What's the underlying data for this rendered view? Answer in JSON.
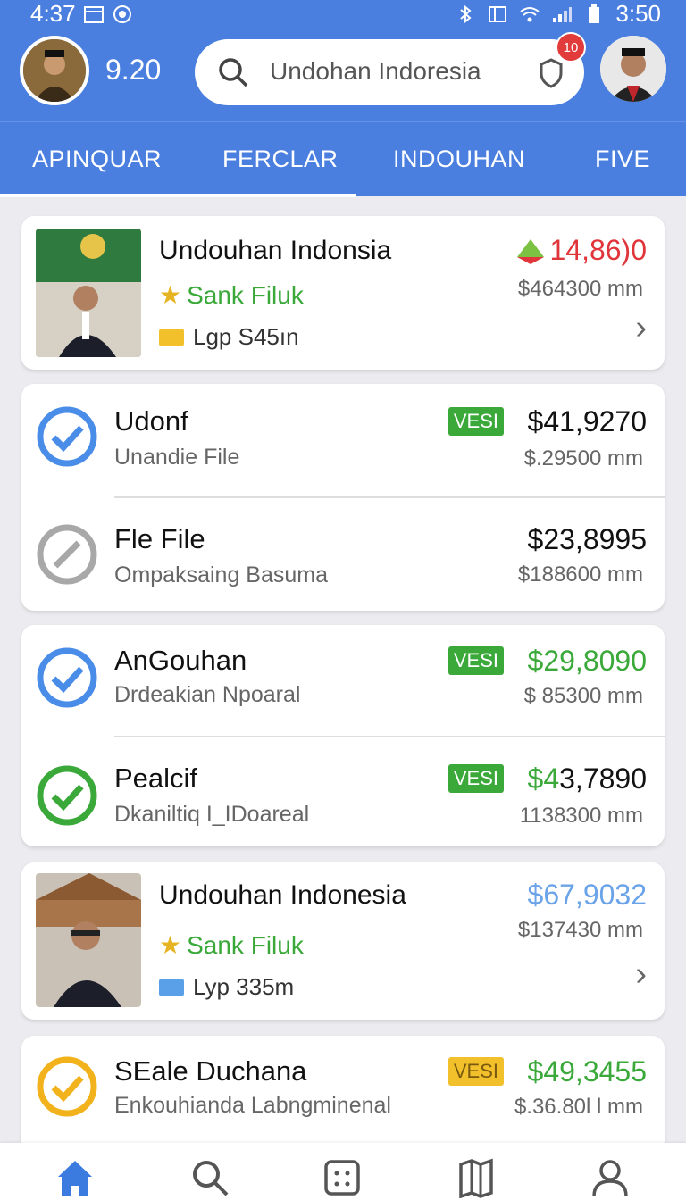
{
  "status_bar": {
    "left_time": "4:37",
    "right_time": "3:50"
  },
  "header": {
    "score": "9.20",
    "search_text": "Undohan Indoresia",
    "notification_count": "10"
  },
  "tabs": [
    "APINQUAR",
    "FERCLAR",
    "INDOUHAN",
    "FIVE"
  ],
  "feature_cards": [
    {
      "title": "Undouhan Indonsia",
      "rating_label": "Sank Filuk",
      "tag_label": "Lgp S45ın",
      "amount": "14,86)0",
      "amount_color": "#e0353a",
      "sub_amount": "$464300 mm"
    },
    {
      "title": "Undouhan Indonesia",
      "rating_label": "Sank Filuk",
      "tag_label": "Lyp 335m",
      "amount": "$67,9032",
      "amount_color": "#6aa3e8",
      "sub_amount": "$137430 mm"
    }
  ],
  "group_one": [
    {
      "title": "Udonf",
      "subtitle": "Unandie File",
      "badge": "VESI",
      "amount": "$41,9270",
      "sub_amount": "$.29500 mm"
    },
    {
      "title": "Fle File",
      "subtitle": "Ompaksaing Basuma",
      "badge": "",
      "amount": "$23,8995",
      "sub_amount": "$188600 mm"
    }
  ],
  "group_two": [
    {
      "title": "AnGouhan",
      "subtitle": "Drdeakian Npoaral",
      "badge": "VESI",
      "amount": "$29,8090",
      "sub_amount": "$ 85300 mm"
    },
    {
      "title": "Pealcif",
      "subtitle": "Dkaniltiq I_IDoareal",
      "badge": "VESI",
      "amount_green": "$4",
      "amount": "3,7890",
      "sub_amount": "1138300 mm"
    }
  ],
  "last_row": {
    "title": "SEale Duchana",
    "subtitle": "Enkouhianda Labngminenal",
    "badge": "VESI",
    "amount": "$49,3455",
    "sub_amount": "$.36.80l l mm"
  },
  "colors": {
    "brand": "#4a7fe0",
    "green": "#3aa93a",
    "blue": "#4a8de8",
    "gray": "#a8a8a8",
    "yellow": "#f2b21b"
  },
  "icons": {
    "nav": [
      "home-icon",
      "search-icon",
      "grid-icon",
      "book-icon",
      "profile-icon"
    ]
  }
}
